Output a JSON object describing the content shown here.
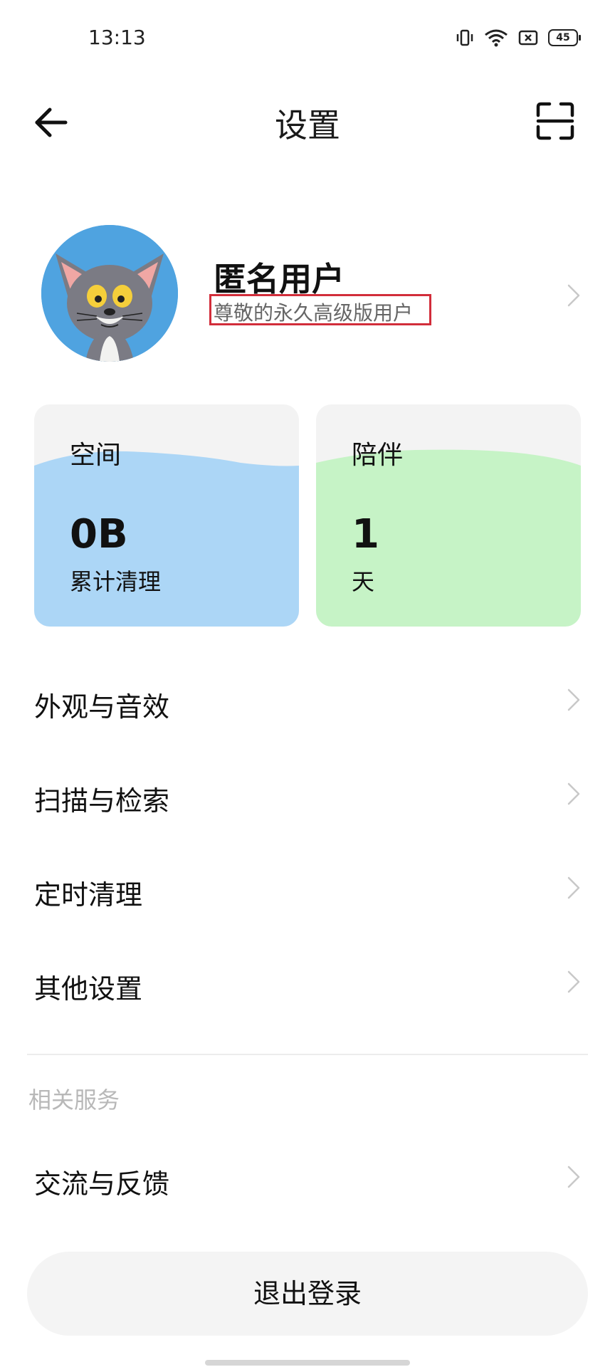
{
  "status_bar": {
    "time": "13:13",
    "battery": "45"
  },
  "header": {
    "title": "设置"
  },
  "profile": {
    "name": "匿名用户",
    "level": "尊敬的永久高级版用户"
  },
  "cards": [
    {
      "title": "空间",
      "value": "0B",
      "label": "累计清理",
      "color": "#acd6f6"
    },
    {
      "title": "陪伴",
      "value": "1",
      "label": "天",
      "color": "#c6f3c6"
    }
  ],
  "menu": [
    {
      "label": "外观与音效"
    },
    {
      "label": "扫描与检索"
    },
    {
      "label": "定时清理"
    },
    {
      "label": "其他设置"
    }
  ],
  "related": {
    "title": "相关服务",
    "items": [
      {
        "label": "交流与反馈"
      }
    ]
  },
  "logout_label": "退出登录"
}
